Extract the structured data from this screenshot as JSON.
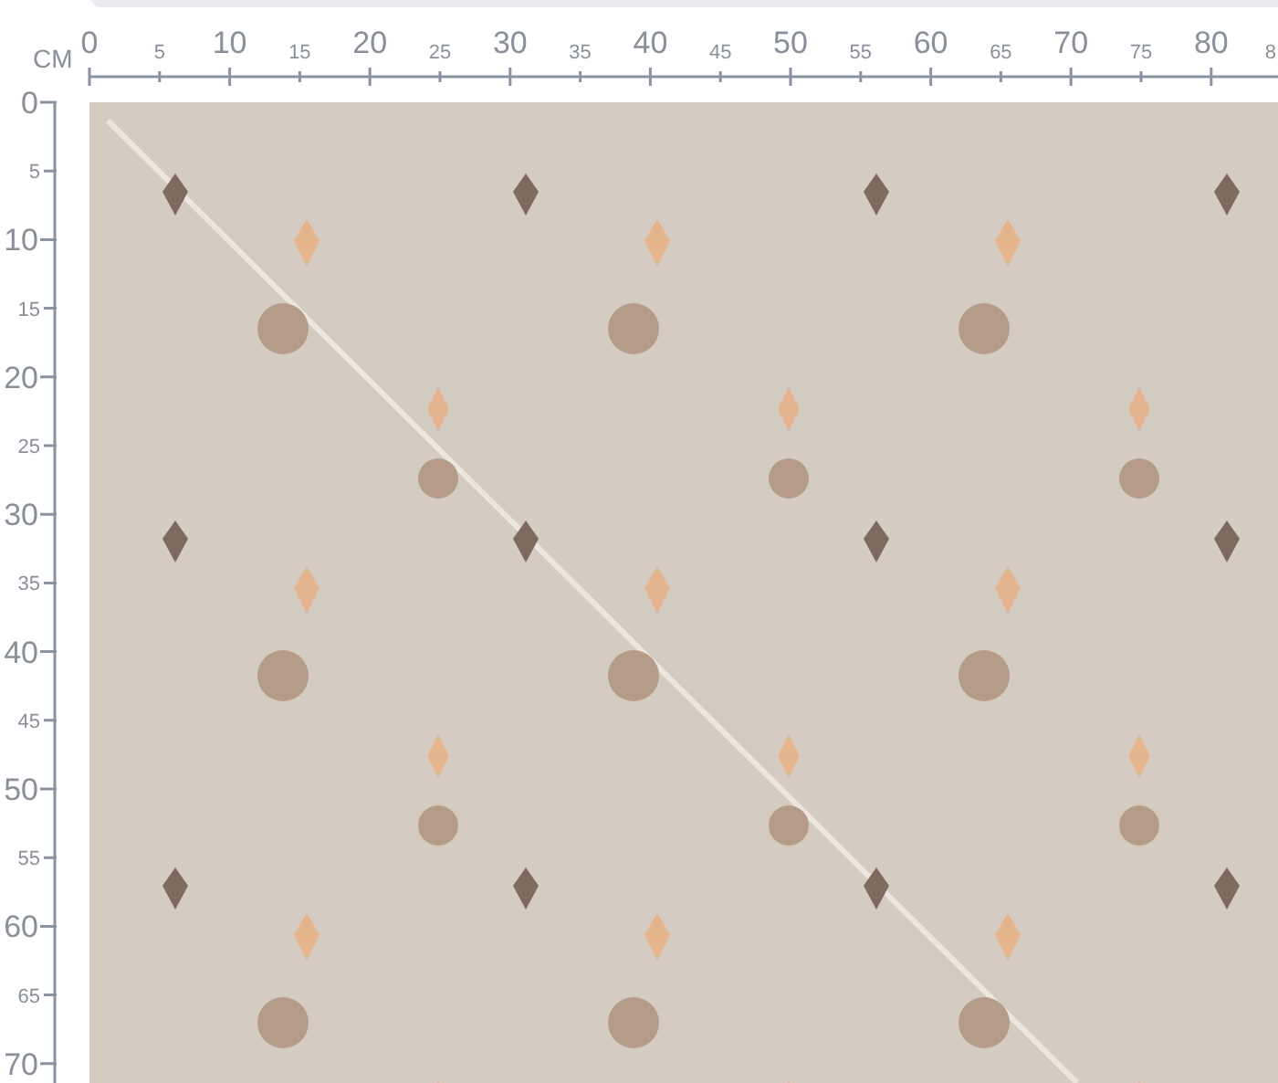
{
  "ruler": {
    "unit": "CM",
    "horizontal_labels": [
      {
        "text": "0",
        "kind": "major"
      },
      {
        "text": "5",
        "kind": "minor"
      },
      {
        "text": "10",
        "kind": "major"
      },
      {
        "text": "15",
        "kind": "minor"
      },
      {
        "text": "20",
        "kind": "major"
      },
      {
        "text": "25",
        "kind": "minor"
      },
      {
        "text": "30",
        "kind": "major"
      },
      {
        "text": "35",
        "kind": "minor"
      },
      {
        "text": "40",
        "kind": "major"
      },
      {
        "text": "45",
        "kind": "minor"
      },
      {
        "text": "50",
        "kind": "major"
      },
      {
        "text": "55",
        "kind": "minor"
      },
      {
        "text": "60",
        "kind": "major"
      },
      {
        "text": "65",
        "kind": "minor"
      },
      {
        "text": "70",
        "kind": "major"
      },
      {
        "text": "75",
        "kind": "minor"
      },
      {
        "text": "80",
        "kind": "major"
      },
      {
        "text": "8",
        "kind": "minor"
      }
    ],
    "vertical_labels": [
      {
        "text": "0",
        "kind": "major"
      },
      {
        "text": "5",
        "kind": "minor"
      },
      {
        "text": "10",
        "kind": "major"
      },
      {
        "text": "15",
        "kind": "minor"
      },
      {
        "text": "20",
        "kind": "major"
      },
      {
        "text": "25",
        "kind": "minor"
      },
      {
        "text": "30",
        "kind": "major"
      },
      {
        "text": "35",
        "kind": "minor"
      },
      {
        "text": "40",
        "kind": "major"
      },
      {
        "text": "45",
        "kind": "minor"
      },
      {
        "text": "50",
        "kind": "major"
      },
      {
        "text": "55",
        "kind": "minor"
      },
      {
        "text": "60",
        "kind": "major"
      },
      {
        "text": "65",
        "kind": "minor"
      },
      {
        "text": "70",
        "kind": "major"
      }
    ]
  }
}
